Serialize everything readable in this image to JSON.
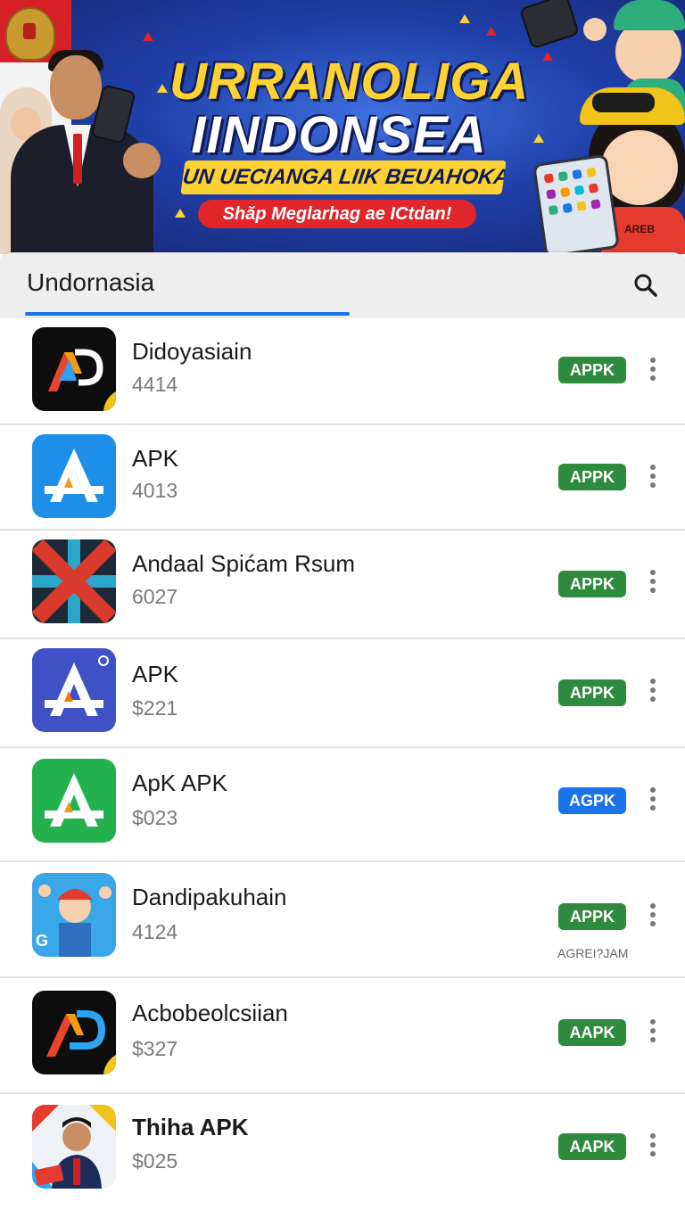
{
  "banner": {
    "title_line1": "URRANOLIGA",
    "title_line2": "IINDONSEA",
    "subtitle": "UN UECIANGA LIIK BEUAHOKA",
    "cta": "Shăp Meglarhag ae ICtdan!",
    "shirt_text": "AREB"
  },
  "search": {
    "title": "Undornasia",
    "icon": "search-icon"
  },
  "apps": [
    {
      "name": "Didoyasiain",
      "sub": "4414",
      "badge": "APPK",
      "badge_color": "#2e8b3d",
      "icon": "ap-logo-dark"
    },
    {
      "name": "APK",
      "sub": "4013",
      "badge": "APPK",
      "badge_color": "#2e8b3d",
      "icon": "a-logo-blue"
    },
    {
      "name": "Andaal Spićam Rsum",
      "sub": "6027",
      "badge": "APPK",
      "badge_color": "#2e8b3d",
      "icon": "crossed-red-logo"
    },
    {
      "name": "APK",
      "sub": "$221",
      "badge": "APPK",
      "badge_color": "#2e8b3d",
      "icon": "a-logo-indigo"
    },
    {
      "name": "ApK APK",
      "sub": "$023",
      "badge": "AGPK",
      "badge_color": "#1a73e8",
      "icon": "a-logo-green"
    },
    {
      "name": "Dandipakuhain",
      "sub": "4124",
      "badge": "APPK",
      "badge_color": "#2e8b3d",
      "icon": "cartoon-kid-logo",
      "caption": "AGREI?JAM"
    },
    {
      "name": "Acbobeolcsiian",
      "sub": "$327",
      "badge": "AAPK",
      "badge_color": "#2e8b3d",
      "icon": "ap-logo-dark"
    },
    {
      "name": "Thiha APK",
      "sub": "$025",
      "badge": "AAPK",
      "badge_color": "#2e8b3d",
      "icon": "man-portrait-logo"
    }
  ]
}
